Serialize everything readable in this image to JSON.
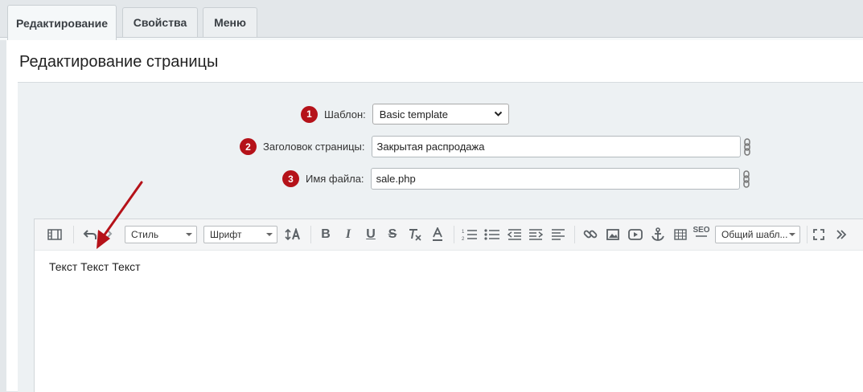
{
  "tabs": [
    {
      "label": "Редактирование",
      "active": true
    },
    {
      "label": "Свойства",
      "active": false
    },
    {
      "label": "Меню",
      "active": false
    }
  ],
  "page": {
    "title": "Редактирование страницы"
  },
  "form": {
    "template": {
      "badge": "1",
      "label": "Шаблон:",
      "value": "Basic template"
    },
    "page_title": {
      "badge": "2",
      "label": "Заголовок страницы:",
      "value": "Закрытая распродажа"
    },
    "file_name": {
      "badge": "3",
      "label": "Имя файла:",
      "value": "sale.php"
    }
  },
  "toolbar": {
    "style_select": "Стиль",
    "font_select": "Шрифт",
    "template_select": "Общий шабл...",
    "seo_label": "SEO",
    "icons": [
      "view-mode-icon",
      "undo-icon",
      "redo-icon",
      "font-size-icon",
      "bold-icon",
      "italic-icon",
      "underline-icon",
      "strikethrough-icon",
      "remove-format-icon",
      "text-color-icon",
      "ordered-list-icon",
      "unordered-list-icon",
      "outdent-icon",
      "indent-icon",
      "align-icon",
      "link-icon",
      "image-icon",
      "video-icon",
      "anchor-icon",
      "table-icon",
      "seo-icon",
      "fullscreen-icon",
      "more-icon"
    ]
  },
  "editor": {
    "content": "Текст Текст Текст"
  },
  "colors": {
    "badge": "#b51219",
    "arrow": "#b51219",
    "tab_bg": "#eceff1",
    "panel_bg": "#edf1f3"
  }
}
